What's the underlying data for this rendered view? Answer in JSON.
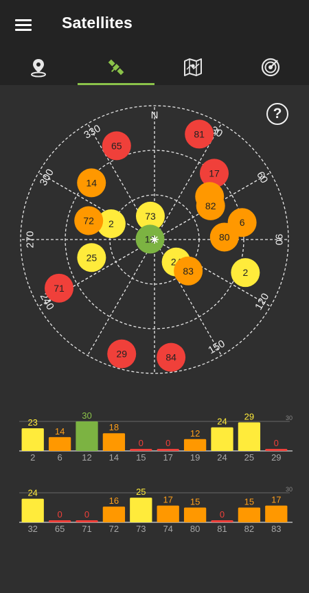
{
  "app": {
    "title": "Satellites"
  },
  "tabs": [
    {
      "name": "location",
      "icon": "location-pin-icon",
      "active": false
    },
    {
      "name": "satellites",
      "icon": "satellite-icon",
      "active": true
    },
    {
      "name": "map",
      "icon": "map-icon",
      "active": false
    },
    {
      "name": "radar",
      "icon": "radar-icon",
      "active": false
    }
  ],
  "help": {
    "label": "?"
  },
  "skyplot": {
    "direction_labels": [
      "N",
      "30",
      "60",
      "90",
      "120",
      "150",
      "",
      "240",
      "270",
      "300",
      "330"
    ],
    "label_angles": [
      0,
      30,
      60,
      90,
      120,
      150,
      180,
      240,
      270,
      300,
      330
    ],
    "satellites": [
      {
        "id": "65",
        "az": 338,
        "el": 22,
        "color": "red"
      },
      {
        "id": "81",
        "az": 23,
        "el": 13,
        "color": "red"
      },
      {
        "id": "17",
        "az": 42,
        "el": 30,
        "color": "red"
      },
      {
        "id": "14",
        "az": 312,
        "el": 33,
        "color": "orange"
      },
      {
        "id": "19",
        "az": 52,
        "el": 43,
        "color": "orange"
      },
      {
        "id": "82",
        "az": 59,
        "el": 46,
        "color": "orange"
      },
      {
        "id": "22",
        "label": "2",
        "az": 290,
        "el": 59,
        "color": "yellow"
      },
      {
        "id": "72",
        "az": 286,
        "el": 44,
        "color": "orange"
      },
      {
        "id": "73",
        "az": 350,
        "el": 74,
        "color": "yellow"
      },
      {
        "id": "6",
        "az": 79,
        "el": 30,
        "color": "orange"
      },
      {
        "id": "12",
        "az": 275,
        "el": 87,
        "color": "green"
      },
      {
        "id": "80",
        "az": 88,
        "el": 43,
        "color": "orange"
      },
      {
        "id": "25",
        "az": 254,
        "el": 46,
        "color": "yellow"
      },
      {
        "id": "24",
        "az": 136,
        "el": 69,
        "color": "yellow"
      },
      {
        "id": "83",
        "az": 133,
        "el": 59,
        "color": "orange"
      },
      {
        "id": "2",
        "az": 110,
        "el": 25,
        "color": "yellow"
      },
      {
        "id": "71",
        "az": 243,
        "el": 18,
        "color": "red"
      },
      {
        "id": "29",
        "az": 196,
        "el": 10,
        "color": "red"
      },
      {
        "id": "84",
        "az": 172,
        "el": 10,
        "color": "red"
      }
    ]
  },
  "bar_groups": [
    {
      "max_label": "30",
      "bars": [
        {
          "sat": "2",
          "snr": 23,
          "color": "yellow"
        },
        {
          "sat": "6",
          "snr": 14,
          "color": "orange"
        },
        {
          "sat": "12",
          "snr": 30,
          "color": "green"
        },
        {
          "sat": "14",
          "snr": 18,
          "color": "orange"
        },
        {
          "sat": "15",
          "snr": 0,
          "color": "red"
        },
        {
          "sat": "17",
          "snr": 0,
          "color": "red"
        },
        {
          "sat": "19",
          "snr": 12,
          "color": "orange"
        },
        {
          "sat": "24",
          "snr": 24,
          "color": "yellow"
        },
        {
          "sat": "25",
          "snr": 29,
          "color": "yellow"
        },
        {
          "sat": "29",
          "snr": 0,
          "color": "red"
        }
      ]
    },
    {
      "max_label": "30",
      "bars": [
        {
          "sat": "32",
          "snr": 24,
          "color": "yellow"
        },
        {
          "sat": "65",
          "snr": 0,
          "color": "red"
        },
        {
          "sat": "71",
          "snr": 0,
          "color": "red"
        },
        {
          "sat": "72",
          "snr": 16,
          "color": "orange"
        },
        {
          "sat": "73",
          "snr": 25,
          "color": "yellow"
        },
        {
          "sat": "74",
          "snr": 17,
          "color": "orange"
        },
        {
          "sat": "80",
          "snr": 15,
          "color": "orange"
        },
        {
          "sat": "81",
          "snr": 0,
          "color": "red"
        },
        {
          "sat": "82",
          "snr": 15,
          "color": "orange"
        },
        {
          "sat": "83",
          "snr": 17,
          "color": "orange"
        }
      ]
    }
  ],
  "colors": {
    "red": "#f0403a",
    "orange": "#ff9800",
    "yellow": "#ffeb3b",
    "green": "#7cb342",
    "value_red": "#f0403a",
    "value_orange": "#ff9f1a",
    "value_yellow": "#ffeb3b",
    "value_green": "#8bc34a",
    "accent": "#8bc34a"
  }
}
